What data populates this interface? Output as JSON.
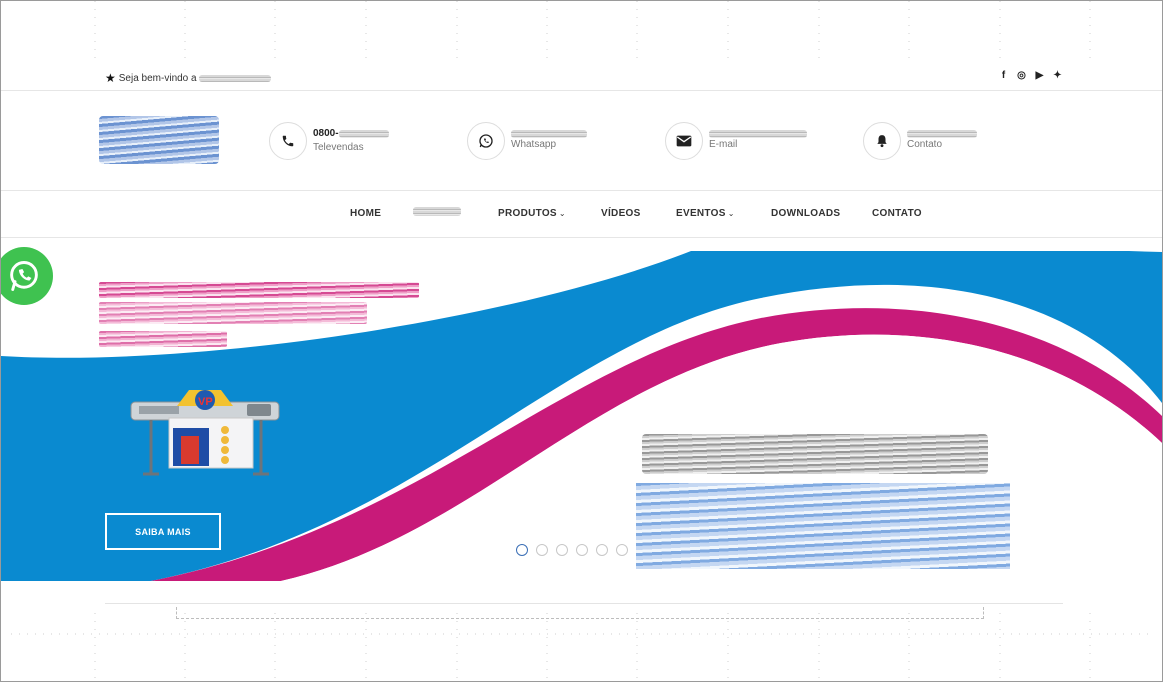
{
  "topbar": {
    "welcome_text": "Seja bem-vindo a",
    "social_icons": [
      "facebook-icon",
      "instagram-icon",
      "youtube-icon",
      "twitter-icon"
    ],
    "social_glyphs": [
      "f",
      "◎",
      "▶",
      "✦"
    ]
  },
  "header": {
    "contacts": [
      {
        "value": "0800-",
        "label": "Televendas",
        "icon": "phone-icon"
      },
      {
        "value": "",
        "label": "Whatsapp",
        "icon": "whatsapp-icon"
      },
      {
        "value": "",
        "label": "E-mail",
        "icon": "envelope-icon"
      },
      {
        "value": "",
        "label": "Contato",
        "icon": "bell-icon"
      }
    ]
  },
  "nav": {
    "items": [
      {
        "label": "HOME"
      },
      {
        "label": ""
      },
      {
        "label": "PRODUTOS",
        "dropdown": true
      },
      {
        "label": "VÍDEOS"
      },
      {
        "label": "EVENTOS",
        "dropdown": true
      },
      {
        "label": "DOWNLOADS"
      },
      {
        "label": "CONTATO"
      }
    ],
    "chevron": "⌄"
  },
  "hero": {
    "button_label": "SAIBA MAIS",
    "slides_count": 6,
    "active_slide": 1,
    "colors": {
      "blue": "#0a8ad0",
      "magenta": "#c81a79",
      "white": "#ffffff"
    }
  },
  "colors": {
    "whatsapp_green": "#3fc250",
    "text_dark": "#333333",
    "border": "#e6e6e6"
  }
}
